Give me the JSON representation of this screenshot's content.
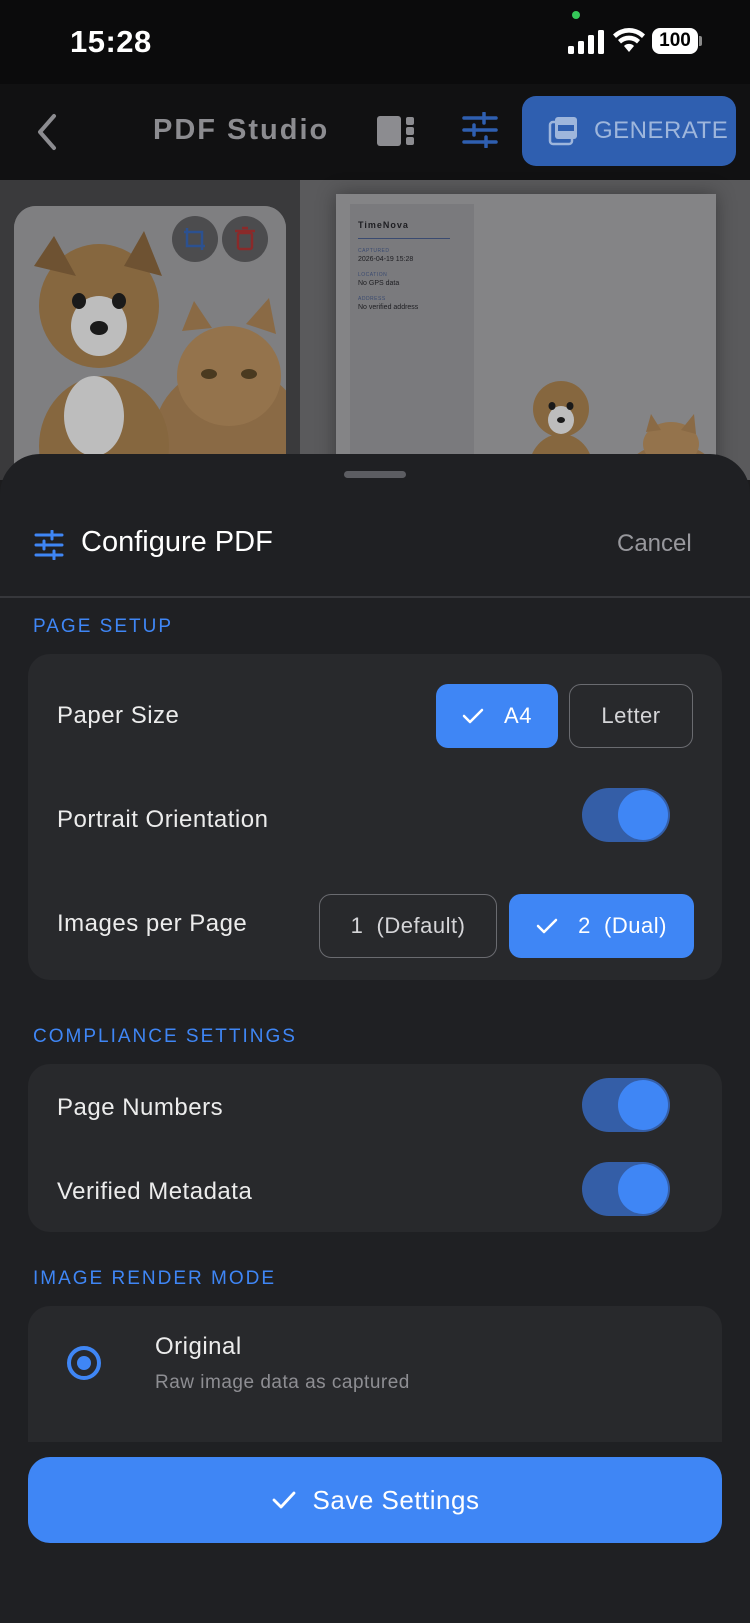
{
  "status_bar": {
    "time": "15:28",
    "battery": "100"
  },
  "app_bar": {
    "title": "PDF Studio",
    "generate_label": "GENERATE"
  },
  "preview": {
    "page_brand": "TimeNova",
    "meta": [
      {
        "key": "CAPTURED",
        "value": "2026-04-19 15:28"
      },
      {
        "key": "LOCATION",
        "value": "No GPS data"
      },
      {
        "key": "ADDRESS",
        "value": "No verified address"
      }
    ]
  },
  "sheet": {
    "title": "Configure PDF",
    "cancel_label": "Cancel",
    "page_setup": {
      "section_label": "PAGE SETUP",
      "paper_size_label": "Paper Size",
      "paper_options": [
        "A4",
        "Letter"
      ],
      "paper_selected": "A4",
      "orientation_label": "Portrait Orientation",
      "orientation_on": true,
      "images_per_page_label": "Images per Page",
      "images_options": [
        "1  (Default)",
        "2  (Dual)"
      ],
      "images_selected": "2  (Dual)"
    },
    "compliance": {
      "section_label": "COMPLIANCE SETTINGS",
      "page_numbers_label": "Page Numbers",
      "page_numbers_on": true,
      "verified_metadata_label": "Verified Metadata",
      "verified_metadata_on": true
    },
    "render_mode": {
      "section_label": "IMAGE RENDER MODE",
      "options": [
        {
          "title": "Original",
          "subtitle": "Raw image data as captured",
          "selected": true
        }
      ]
    },
    "save_label": "Save Settings"
  },
  "colors": {
    "accent": "#3f86f5",
    "sheet_bg": "#1f2023",
    "card_bg": "#28292c"
  }
}
